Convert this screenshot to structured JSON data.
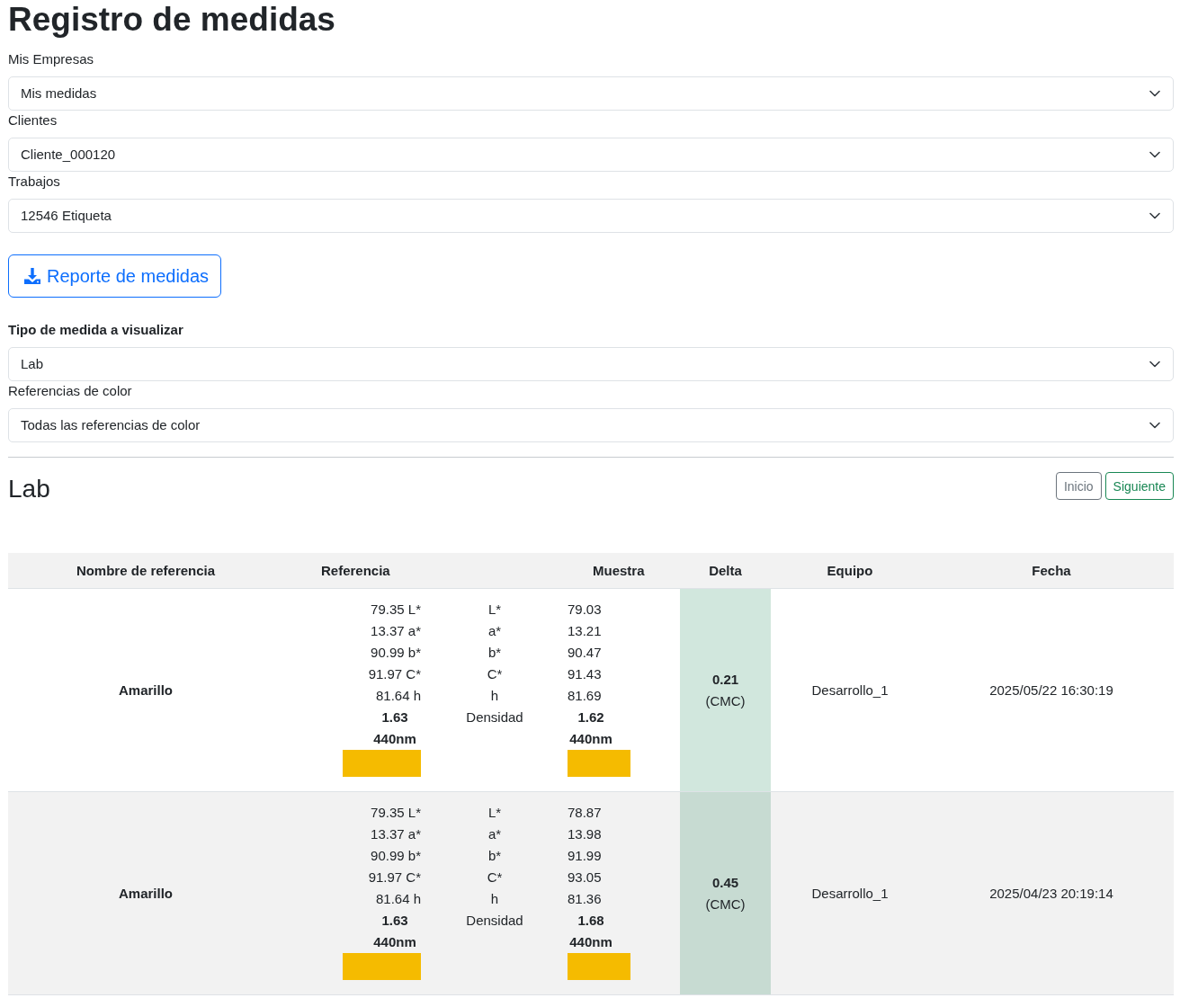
{
  "page_title": "Registro de medidas",
  "filters": [
    {
      "label": "Mis Empresas",
      "value": "Mis medidas"
    },
    {
      "label": "Clientes",
      "value": "Cliente_000120"
    },
    {
      "label": "Trabajos",
      "value": "12546 Etiqueta"
    }
  ],
  "report_button": {
    "label": "Reporte de medidas"
  },
  "measure_type": {
    "label": "Tipo de medida a visualizar",
    "value": "Lab"
  },
  "color_references": {
    "label": "Referencias de color",
    "value": "Todas las referencias de color"
  },
  "section": {
    "title": "Lab",
    "buttons": [
      {
        "label": "Inicio",
        "kind": "first"
      },
      {
        "label": "Siguiente",
        "kind": "next"
      }
    ]
  },
  "table": {
    "columns": [
      "Nombre de referencia",
      "Referencia",
      "Muestra",
      "Delta",
      "Equipo",
      "Fecha"
    ],
    "rows": [
      {
        "name": "Amarillo",
        "reference": {
          "values": [
            "79.35 L*",
            "13.37 a*",
            "90.99 b*",
            "91.97 C*",
            "81.64 h"
          ],
          "density": "1.63",
          "wavelength": "440nm",
          "color": "#f5bb00"
        },
        "labels": [
          "L*",
          "a*",
          "b*",
          "C*",
          "h",
          "Densidad"
        ],
        "sample": {
          "values": [
            "79.03",
            "13.21",
            "90.47",
            "91.43",
            "81.69"
          ],
          "density": "1.62",
          "wavelength": "440nm",
          "color": "#f5bb00"
        },
        "delta": {
          "value": "0.21",
          "method": "(CMC)"
        },
        "device": "Desarrollo_1",
        "date": "2025/05/22 16:30:19"
      },
      {
        "name": "Amarillo",
        "reference": {
          "values": [
            "79.35 L*",
            "13.37 a*",
            "90.99 b*",
            "91.97 C*",
            "81.64 h"
          ],
          "density": "1.63",
          "wavelength": "440nm",
          "color": "#f5bb00"
        },
        "labels": [
          "L*",
          "a*",
          "b*",
          "C*",
          "h",
          "Densidad"
        ],
        "sample": {
          "values": [
            "78.87",
            "13.98",
            "91.99",
            "93.05",
            "81.36"
          ],
          "density": "1.68",
          "wavelength": "440nm",
          "color": "#f5bb00"
        },
        "delta": {
          "value": "0.45",
          "method": "(CMC)"
        },
        "device": "Desarrollo_1",
        "date": "2025/04/23 20:19:14"
      }
    ]
  }
}
